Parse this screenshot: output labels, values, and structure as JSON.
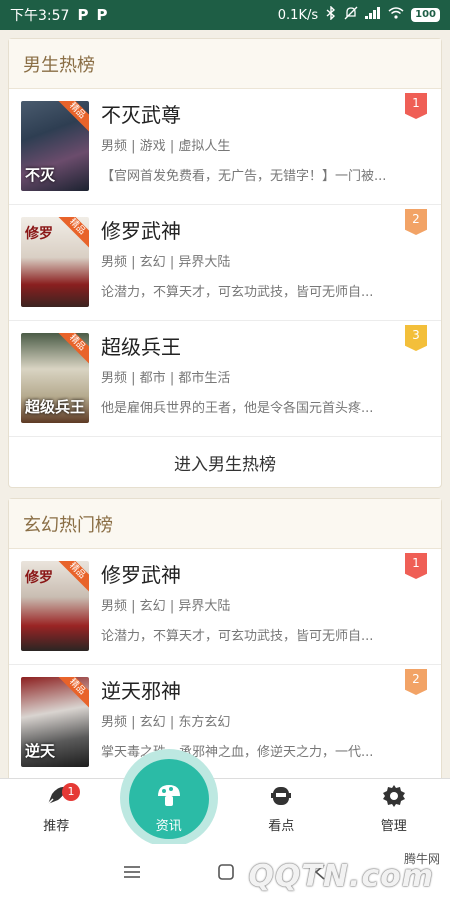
{
  "status": {
    "time": "下午3:57",
    "p1": "P",
    "p2": "P",
    "speed": "0.1K/s",
    "battery": "100"
  },
  "sections": [
    {
      "title": "男生热榜",
      "more": "进入男生热榜",
      "books": [
        {
          "title": "不灭武尊",
          "rank": "1",
          "tag": "精品",
          "cover_text": "不灭",
          "meta": [
            "男频",
            "游戏",
            "虚拟人生"
          ],
          "desc": "【官网首发免费看，无广告，无错字！】一门被..."
        },
        {
          "title": "修罗武神",
          "rank": "2",
          "tag": "精品",
          "cover_text": "修罗",
          "meta": [
            "男频",
            "玄幻",
            "异界大陆"
          ],
          "desc": "论潜力，不算天才，可玄功武技，皆可无师自..."
        },
        {
          "title": "超级兵王",
          "rank": "3",
          "tag": "精品",
          "cover_text": "超级兵王",
          "meta": [
            "男频",
            "都市",
            "都市生活"
          ],
          "desc": "他是雇佣兵世界的王者，他是令各国元首头疼..."
        }
      ]
    },
    {
      "title": "玄幻热门榜",
      "books": [
        {
          "title": "修罗武神",
          "rank": "1",
          "tag": "精品",
          "cover_text": "修罗",
          "meta": [
            "男频",
            "玄幻",
            "异界大陆"
          ],
          "desc": "论潜力，不算天才，可玄功武技，皆可无师自..."
        },
        {
          "title": "逆天邪神",
          "rank": "2",
          "tag": "精品",
          "cover_text": "逆天",
          "meta": [
            "男频",
            "玄幻",
            "东方玄幻"
          ],
          "desc": "掌天毒之珠，承邪神之血，修逆天之力，一代..."
        }
      ]
    }
  ],
  "tabs": [
    {
      "label": "推荐",
      "icon": "rocket-icon",
      "badge": "1"
    },
    {
      "label": "资讯",
      "icon": "mushroom-icon"
    },
    {
      "label": "看点",
      "icon": "robot-icon"
    },
    {
      "label": "管理",
      "icon": "gear-icon"
    }
  ],
  "watermark": {
    "text": "腾牛网",
    "logo": "QQTN.com"
  },
  "colors": {
    "status_bar": "#1e5e45",
    "accent": "#2bbba6",
    "section_title": "#8a6e45",
    "rank1": "#ef5f56",
    "rank2": "#f2a366",
    "rank3": "#f3bf3a"
  }
}
